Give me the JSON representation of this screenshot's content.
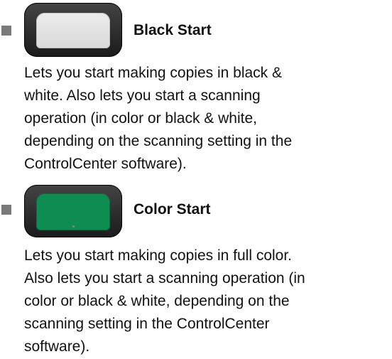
{
  "entries": [
    {
      "title": "Black Start",
      "key_color": "#e6e6e6",
      "description_lines": [
        "Lets you start making copies in black &",
        "white. Also lets you start a scanning",
        "operation (in color or black & white,",
        "depending on the scanning setting in the",
        "ControlCenter software)."
      ]
    },
    {
      "title": "Color Start",
      "key_color": "#0f8c52",
      "description_lines": [
        "Lets you start making copies in full color.",
        "Also lets you start a scanning operation (in",
        "color or black & white, depending on the",
        "scanning setting in the ControlCenter",
        "software)."
      ]
    }
  ]
}
